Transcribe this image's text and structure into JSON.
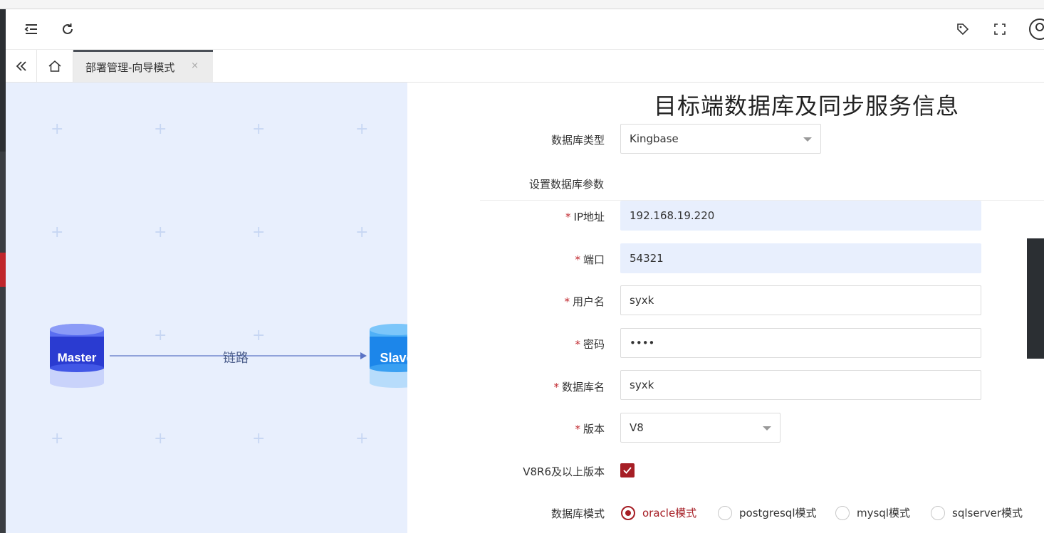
{
  "header": {
    "menu_icon": "menu-fold-icon",
    "refresh_icon": "refresh-icon",
    "tag_icon": "tag-icon",
    "fullscreen_icon": "fullscreen-icon",
    "user_icon": "user-avatar-icon"
  },
  "tabs": {
    "collapse_icon": "double-chevron-left-icon",
    "home_icon": "home-icon",
    "active_tab_label": "部署管理-向导模式",
    "close_symbol": "×"
  },
  "diagram": {
    "master_label": "Master",
    "slave_label": "Slave",
    "link_label": "链路"
  },
  "form": {
    "title": "目标端数据库及同步服务信息",
    "db_type_label": "数据库类型",
    "db_type_value": "Kingbase",
    "section_label": "设置数据库参数",
    "required_mark": "*",
    "ip_label": "IP地址",
    "ip_value": "192.168.19.220",
    "port_label": "端口",
    "port_value": "54321",
    "user_label": "用户名",
    "user_value": "syxk",
    "password_label": "密码",
    "password_value": "••••",
    "dbname_label": "数据库名",
    "dbname_value": "syxk",
    "version_label": "版本",
    "version_value": "V8",
    "v8r6_label": "V8R6及以上版本",
    "v8r6_checked": true,
    "mode_label": "数据库模式",
    "modes": [
      {
        "label": "oracle模式",
        "selected": true
      },
      {
        "label": "postgresql模式",
        "selected": false
      },
      {
        "label": "mysql模式",
        "selected": false
      },
      {
        "label": "sqlserver模式",
        "selected": false
      }
    ]
  },
  "colors": {
    "accent": "#a61e25",
    "input_filled_bg": "#e8effd",
    "diagram_bg": "#e8effd"
  }
}
